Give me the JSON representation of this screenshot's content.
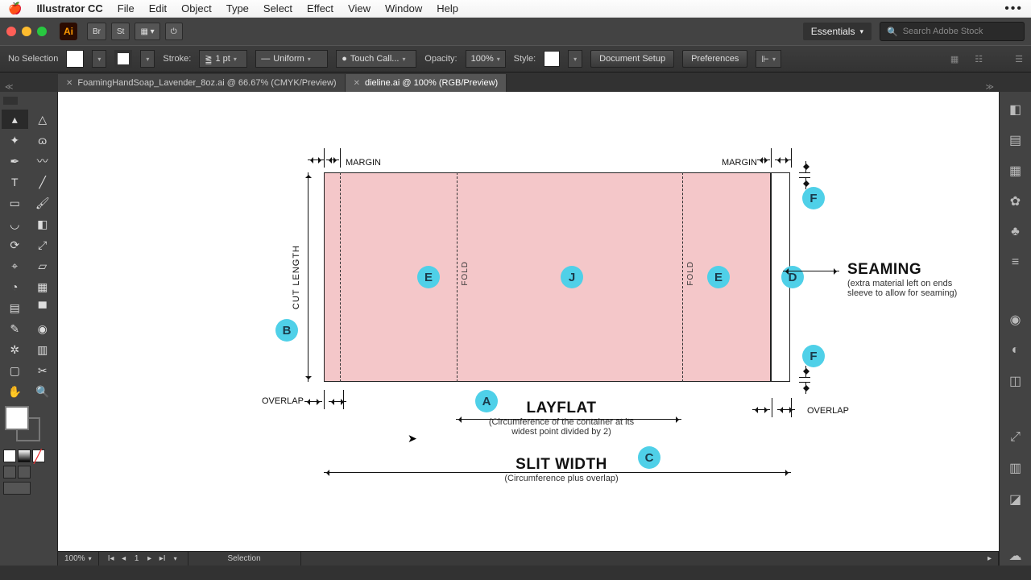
{
  "mac_menu": {
    "app": "Illustrator CC",
    "items": [
      "File",
      "Edit",
      "Object",
      "Type",
      "Select",
      "Effect",
      "View",
      "Window",
      "Help"
    ]
  },
  "appbar": {
    "ai": "Ai",
    "br": "Br",
    "st": "St",
    "workspace": "Essentials",
    "search_placeholder": "Search Adobe Stock"
  },
  "controlbar": {
    "selection": "No Selection",
    "stroke_label": "Stroke:",
    "stroke_val": "1 pt",
    "uniform": "Uniform",
    "brush": "Touch Call...",
    "opacity_label": "Opacity:",
    "opacity_val": "100%",
    "style_label": "Style:",
    "docsetup": "Document Setup",
    "prefs": "Preferences"
  },
  "tabs": {
    "t1": "FoamingHandSoap_Lavender_8oz.ai @ 66.67% (CMYK/Preview)",
    "t2": "dieline.ai @ 100% (RGB/Preview)"
  },
  "dieline": {
    "margin": "MARGIN",
    "fold": "FOLD",
    "cutlength": "CUT LENGTH",
    "overlap": "OVERLAP",
    "layflat": "LAYFLAT",
    "layflat_sub": "(Circumference of the container at its widest point divided by 2)",
    "slit": "SLIT WIDTH",
    "slit_sub": "(Circumference plus overlap)",
    "seaming": "SEAMING",
    "seaming_sub": "(extra material left on ends sleeve to allow for seaming)",
    "b": {
      "A": "A",
      "B": "B",
      "C": "C",
      "D": "D",
      "E": "E",
      "F": "F",
      "J": "J"
    }
  },
  "status": {
    "zoom": "100%",
    "page": "1",
    "tool": "Selection"
  }
}
